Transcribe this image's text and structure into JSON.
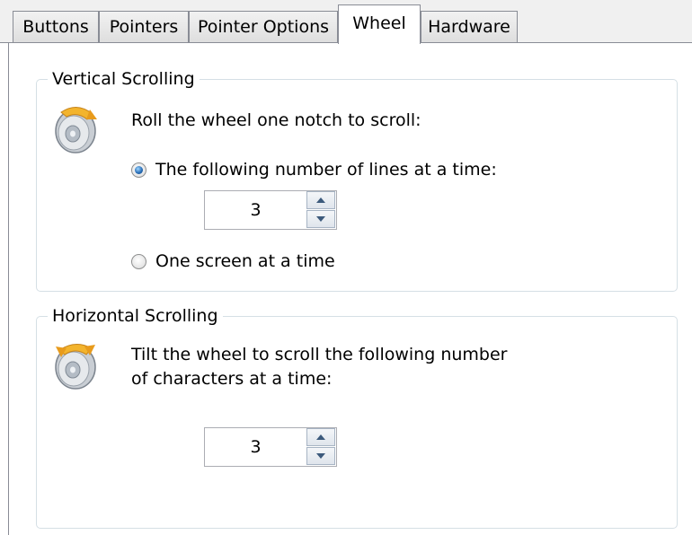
{
  "tabs": [
    {
      "label": "Buttons",
      "active": false
    },
    {
      "label": "Pointers",
      "active": false
    },
    {
      "label": "Pointer Options",
      "active": false
    },
    {
      "label": "Wheel",
      "active": true
    },
    {
      "label": "Hardware",
      "active": false
    }
  ],
  "vertical": {
    "title": "Vertical Scrolling",
    "icon": "mouse-wheel-vertical-icon",
    "instruction": "Roll the wheel one notch to scroll:",
    "option_lines_label": "The following number of lines at a time:",
    "option_lines_checked": true,
    "lines_value": "3",
    "option_screen_label": "One screen at a time",
    "option_screen_checked": false
  },
  "horizontal": {
    "title": "Horizontal Scrolling",
    "icon": "mouse-wheel-horizontal-icon",
    "instruction_line1": "Tilt the wheel to scroll the following number",
    "instruction_line2": "of characters at a time:",
    "chars_value": "3"
  },
  "colors": {
    "active_radio": "#2a6fb8",
    "group_border": "#d5dfe5",
    "tab_border": "#898c95"
  }
}
